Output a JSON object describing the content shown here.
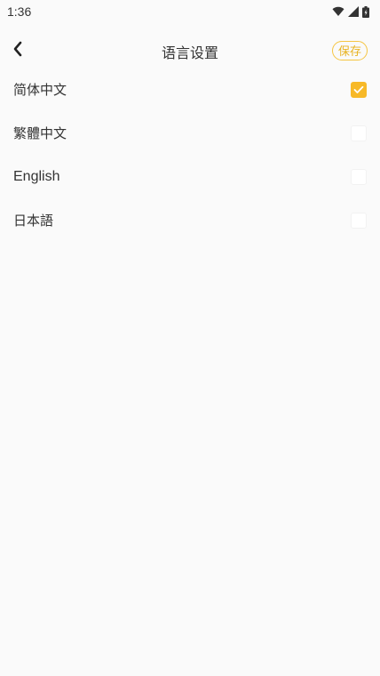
{
  "status_bar": {
    "time": "1:36",
    "icons": [
      "wifi-icon",
      "cell-signal-icon",
      "battery-icon"
    ]
  },
  "header": {
    "back_icon": "chevron-left-icon",
    "title": "语言设置",
    "save_label": "保存"
  },
  "languages": [
    {
      "label": "简体中文",
      "checked": true
    },
    {
      "label": "繁體中文",
      "checked": false
    },
    {
      "label": "English",
      "checked": false
    },
    {
      "label": "日本語",
      "checked": false
    }
  ],
  "colors": {
    "accent": "#f7b928",
    "background": "#fafafa",
    "text": "#333333"
  }
}
